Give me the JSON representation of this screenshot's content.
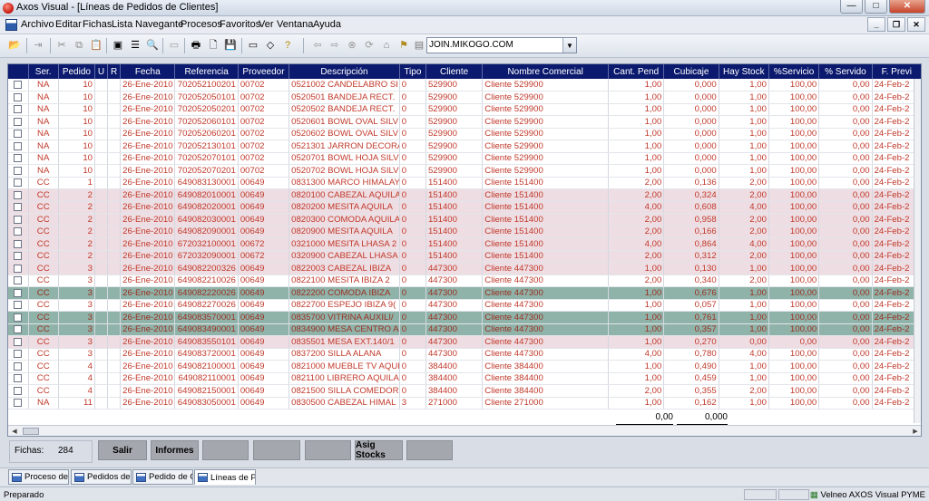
{
  "window": {
    "title": "Axos Visual - [Líneas de Pedidos de Clientes]"
  },
  "menu": [
    "Archivo",
    "Editar",
    "Fichas",
    "Lista",
    "Navegante",
    "Procesos",
    "Favoritos",
    "Ver",
    "Ventana",
    "Ayuda"
  ],
  "toolbar": {
    "combo_value": "JOIN.MIKOGO.COM"
  },
  "table": {
    "columns": [
      "",
      "Ser.",
      "Pedido",
      "U",
      "R",
      "Fecha",
      "Referencia",
      "Proveedor",
      "Descripción",
      "Tipo",
      "Cliente",
      "Nombre Comercial",
      "Cant. Pend",
      "Cubicaje",
      "Hay Stock",
      "%Servicio",
      "% Servido",
      "F. Previ"
    ],
    "rows": [
      {
        "ser": "NA",
        "pedido": "10",
        "fecha": "26-Ene-2010",
        "ref": "702052100201",
        "prov": "00702",
        "desc": "0521002 CANDELABRO SI",
        "tipo": "0",
        "cliente": "529900",
        "nombre": "Cliente 529900",
        "cant": "1,00",
        "cub": "0,000",
        "stock": "1,00",
        "serv": "100,00",
        "servido": "0,00",
        "fprev": "24-Feb-2",
        "style": "na"
      },
      {
        "ser": "NA",
        "pedido": "10",
        "fecha": "26-Ene-2010",
        "ref": "702052050101",
        "prov": "00702",
        "desc": "0520501 BANDEJA RECT.",
        "tipo": "0",
        "cliente": "529900",
        "nombre": "Cliente 529900",
        "cant": "1,00",
        "cub": "0,000",
        "stock": "1,00",
        "serv": "100,00",
        "servido": "0,00",
        "fprev": "24-Feb-2",
        "style": "na"
      },
      {
        "ser": "NA",
        "pedido": "10",
        "fecha": "26-Ene-2010",
        "ref": "702052050201",
        "prov": "00702",
        "desc": "0520502 BANDEJA RECT.",
        "tipo": "0",
        "cliente": "529900",
        "nombre": "Cliente 529900",
        "cant": "1,00",
        "cub": "0,000",
        "stock": "1,00",
        "serv": "100,00",
        "servido": "0,00",
        "fprev": "24-Feb-2",
        "style": "na"
      },
      {
        "ser": "NA",
        "pedido": "10",
        "fecha": "26-Ene-2010",
        "ref": "702052060101",
        "prov": "00702",
        "desc": "0520601 BOWL OVAL SILV",
        "tipo": "0",
        "cliente": "529900",
        "nombre": "Cliente 529900",
        "cant": "1,00",
        "cub": "0,000",
        "stock": "1,00",
        "serv": "100,00",
        "servido": "0,00",
        "fprev": "24-Feb-2",
        "style": "na"
      },
      {
        "ser": "NA",
        "pedido": "10",
        "fecha": "26-Ene-2010",
        "ref": "702052060201",
        "prov": "00702",
        "desc": "0520602 BOWL OVAL SILV",
        "tipo": "0",
        "cliente": "529900",
        "nombre": "Cliente 529900",
        "cant": "1,00",
        "cub": "0,000",
        "stock": "1,00",
        "serv": "100,00",
        "servido": "0,00",
        "fprev": "24-Feb-2",
        "style": "na"
      },
      {
        "ser": "NA",
        "pedido": "10",
        "fecha": "26-Ene-2010",
        "ref": "702052130101",
        "prov": "00702",
        "desc": "0521301 JARRON DECORA",
        "tipo": "0",
        "cliente": "529900",
        "nombre": "Cliente 529900",
        "cant": "1,00",
        "cub": "0,000",
        "stock": "1,00",
        "serv": "100,00",
        "servido": "0,00",
        "fprev": "24-Feb-2",
        "style": "na"
      },
      {
        "ser": "NA",
        "pedido": "10",
        "fecha": "26-Ene-2010",
        "ref": "702052070101",
        "prov": "00702",
        "desc": "0520701 BOWL HOJA SILV",
        "tipo": "0",
        "cliente": "529900",
        "nombre": "Cliente 529900",
        "cant": "1,00",
        "cub": "0,000",
        "stock": "1,00",
        "serv": "100,00",
        "servido": "0,00",
        "fprev": "24-Feb-2",
        "style": "na"
      },
      {
        "ser": "NA",
        "pedido": "10",
        "fecha": "26-Ene-2010",
        "ref": "702052070201",
        "prov": "00702",
        "desc": "0520702 BOWL HOJA SILV",
        "tipo": "0",
        "cliente": "529900",
        "nombre": "Cliente 529900",
        "cant": "1,00",
        "cub": "0,000",
        "stock": "1,00",
        "serv": "100,00",
        "servido": "0,00",
        "fprev": "24-Feb-2",
        "style": "na"
      },
      {
        "ser": "CC",
        "pedido": "1",
        "fecha": "26-Ene-2010",
        "ref": "649083130001",
        "prov": "00649",
        "desc": "0831300 MARCO HIMALAY",
        "tipo": "0",
        "cliente": "151400",
        "nombre": "Cliente 151400",
        "cant": "2,00",
        "cub": "0,136",
        "stock": "2,00",
        "serv": "100,00",
        "servido": "0,00",
        "fprev": "24-Feb-2",
        "style": "cc white"
      },
      {
        "ser": "CC",
        "pedido": "2",
        "fecha": "26-Ene-2010",
        "ref": "649082010001",
        "prov": "00649",
        "desc": "0820100 CABEZAL AQUILA",
        "tipo": "0",
        "cliente": "151400",
        "nombre": "Cliente 151400",
        "cant": "2,00",
        "cub": "0,324",
        "stock": "2,00",
        "serv": "100,00",
        "servido": "0,00",
        "fprev": "24-Feb-2",
        "style": "cc"
      },
      {
        "ser": "CC",
        "pedido": "2",
        "fecha": "26-Ene-2010",
        "ref": "649082020001",
        "prov": "00649",
        "desc": "0820200 MESITA AQUILA",
        "tipo": "0",
        "cliente": "151400",
        "nombre": "Cliente 151400",
        "cant": "4,00",
        "cub": "0,608",
        "stock": "4,00",
        "serv": "100,00",
        "servido": "0,00",
        "fprev": "24-Feb-2",
        "style": "cc"
      },
      {
        "ser": "CC",
        "pedido": "2",
        "fecha": "26-Ene-2010",
        "ref": "649082030001",
        "prov": "00649",
        "desc": "0820300 COMODA AQUILA",
        "tipo": "0",
        "cliente": "151400",
        "nombre": "Cliente 151400",
        "cant": "2,00",
        "cub": "0,958",
        "stock": "2,00",
        "serv": "100,00",
        "servido": "0,00",
        "fprev": "24-Feb-2",
        "style": "cc"
      },
      {
        "ser": "CC",
        "pedido": "2",
        "fecha": "26-Ene-2010",
        "ref": "649082090001",
        "prov": "00649",
        "desc": "0820900 MESITA AQUILA",
        "tipo": "0",
        "cliente": "151400",
        "nombre": "Cliente 151400",
        "cant": "2,00",
        "cub": "0,166",
        "stock": "2,00",
        "serv": "100,00",
        "servido": "0,00",
        "fprev": "24-Feb-2",
        "style": "cc"
      },
      {
        "ser": "CC",
        "pedido": "2",
        "fecha": "26-Ene-2010",
        "ref": "672032100001",
        "prov": "00672",
        "desc": "0321000 MESITA LHASA 2",
        "tipo": "0",
        "cliente": "151400",
        "nombre": "Cliente 151400",
        "cant": "4,00",
        "cub": "0,864",
        "stock": "4,00",
        "serv": "100,00",
        "servido": "0,00",
        "fprev": "24-Feb-2",
        "style": "cc"
      },
      {
        "ser": "CC",
        "pedido": "2",
        "fecha": "26-Ene-2010",
        "ref": "672032090001",
        "prov": "00672",
        "desc": "0320900 CABEZAL LHASA",
        "tipo": "0",
        "cliente": "151400",
        "nombre": "Cliente 151400",
        "cant": "2,00",
        "cub": "0,312",
        "stock": "2,00",
        "serv": "100,00",
        "servido": "0,00",
        "fprev": "24-Feb-2",
        "style": "cc"
      },
      {
        "ser": "CC",
        "pedido": "3",
        "fecha": "26-Ene-2010",
        "ref": "649082200326",
        "prov": "00649",
        "desc": "0822003 CABEZAL IBIZA",
        "tipo": "0",
        "cliente": "447300",
        "nombre": "Cliente 447300",
        "cant": "1,00",
        "cub": "0,130",
        "stock": "1,00",
        "serv": "100,00",
        "servido": "0,00",
        "fprev": "24-Feb-2",
        "style": "cc"
      },
      {
        "ser": "CC",
        "pedido": "3",
        "fecha": "26-Ene-2010",
        "ref": "649082210026",
        "prov": "00649",
        "desc": "0822100 MESITA IBIZA 2",
        "tipo": "0",
        "cliente": "447300",
        "nombre": "Cliente 447300",
        "cant": "2,00",
        "cub": "0,340",
        "stock": "2,00",
        "serv": "100,00",
        "servido": "0,00",
        "fprev": "24-Feb-2",
        "style": "cc white"
      },
      {
        "ser": "CC",
        "pedido": "3",
        "fecha": "26-Ene-2010",
        "ref": "649082220026",
        "prov": "00649",
        "desc": "0822200 COMODA IBIZA",
        "tipo": "0",
        "cliente": "447300",
        "nombre": "Cliente 447300",
        "cant": "1,00",
        "cub": "0,676",
        "stock": "1,00",
        "serv": "100,00",
        "servido": "0,00",
        "fprev": "24-Feb-2",
        "style": "sel"
      },
      {
        "ser": "CC",
        "pedido": "3",
        "fecha": "26-Ene-2010",
        "ref": "649082270026",
        "prov": "00649",
        "desc": "0822700 ESPEJO IBIZA 9(",
        "tipo": "0",
        "cliente": "447300",
        "nombre": "Cliente 447300",
        "cant": "1,00",
        "cub": "0,057",
        "stock": "1,00",
        "serv": "100,00",
        "servido": "0,00",
        "fprev": "24-Feb-2",
        "style": "cc white"
      },
      {
        "ser": "CC",
        "pedido": "3",
        "fecha": "26-Ene-2010",
        "ref": "649083570001",
        "prov": "00649",
        "desc": "0835700 VITRINA AUXILI/",
        "tipo": "0",
        "cliente": "447300",
        "nombre": "Cliente 447300",
        "cant": "1,00",
        "cub": "0,761",
        "stock": "1,00",
        "serv": "100,00",
        "servido": "0,00",
        "fprev": "24-Feb-2",
        "style": "sel"
      },
      {
        "ser": "CC",
        "pedido": "3",
        "fecha": "26-Ene-2010",
        "ref": "649083490001",
        "prov": "00649",
        "desc": "0834900 MESA CENTRO A",
        "tipo": "0",
        "cliente": "447300",
        "nombre": "Cliente 447300",
        "cant": "1,00",
        "cub": "0,357",
        "stock": "1,00",
        "serv": "100,00",
        "servido": "0,00",
        "fprev": "24-Feb-2",
        "style": "sel"
      },
      {
        "ser": "CC",
        "pedido": "3",
        "fecha": "26-Ene-2010",
        "ref": "649083550101",
        "prov": "00649",
        "desc": "0835501 MESA EXT.140/1",
        "tipo": "0",
        "cliente": "447300",
        "nombre": "Cliente 447300",
        "cant": "1,00",
        "cub": "0,270",
        "stock": "0,00",
        "serv": "0,00",
        "servido": "0,00",
        "fprev": "24-Feb-2",
        "style": "cc"
      },
      {
        "ser": "CC",
        "pedido": "3",
        "fecha": "26-Ene-2010",
        "ref": "649083720001",
        "prov": "00649",
        "desc": "0837200 SILLA ALANA",
        "tipo": "0",
        "cliente": "447300",
        "nombre": "Cliente 447300",
        "cant": "4,00",
        "cub": "0,780",
        "stock": "4,00",
        "serv": "100,00",
        "servido": "0,00",
        "fprev": "24-Feb-2",
        "style": "cc white"
      },
      {
        "ser": "CC",
        "pedido": "4",
        "fecha": "26-Ene-2010",
        "ref": "649082100001",
        "prov": "00649",
        "desc": "0821000 MUEBLE TV AQUI",
        "tipo": "0",
        "cliente": "384400",
        "nombre": "Cliente 384400",
        "cant": "1,00",
        "cub": "0,490",
        "stock": "1,00",
        "serv": "100,00",
        "servido": "0,00",
        "fprev": "24-Feb-2",
        "style": "cc white"
      },
      {
        "ser": "CC",
        "pedido": "4",
        "fecha": "26-Ene-2010",
        "ref": "649082110001",
        "prov": "00649",
        "desc": "0821100 LIBRERO AQUILA",
        "tipo": "0",
        "cliente": "384400",
        "nombre": "Cliente 384400",
        "cant": "1,00",
        "cub": "0,459",
        "stock": "1,00",
        "serv": "100,00",
        "servido": "0,00",
        "fprev": "24-Feb-2",
        "style": "cc white"
      },
      {
        "ser": "CC",
        "pedido": "4",
        "fecha": "26-Ene-2010",
        "ref": "649082150001",
        "prov": "00649",
        "desc": "0821500 SILLA COMEDOR",
        "tipo": "0",
        "cliente": "384400",
        "nombre": "Cliente 384400",
        "cant": "2,00",
        "cub": "0,355",
        "stock": "2,00",
        "serv": "100,00",
        "servido": "0,00",
        "fprev": "24-Feb-2",
        "style": "cc white"
      },
      {
        "ser": "NA",
        "pedido": "11",
        "fecha": "26-Ene-2010",
        "ref": "649083050001",
        "prov": "00649",
        "desc": "0830500 CABEZAL HIMAL",
        "tipo": "3",
        "cliente": "271000",
        "nombre": "Cliente 271000",
        "cant": "1,00",
        "cub": "0,162",
        "stock": "1,00",
        "serv": "100,00",
        "servido": "0,00",
        "fprev": "24-Feb-2",
        "style": "na"
      }
    ],
    "totals": {
      "cant": "0,00",
      "cub": "0,000"
    }
  },
  "footer": {
    "fichas_label": "Fichas:",
    "fichas_value": "284",
    "buttons": [
      "Salir",
      "Informes",
      "",
      "",
      "",
      "Asig Stocks",
      ""
    ]
  },
  "tabs": [
    "Proceso de ...",
    "Pedidos de ...",
    "Pedido de C...",
    "Líneas de P..."
  ],
  "status": {
    "text": "Preparado",
    "app": "Velneo AXOS Visual PYME"
  },
  "colors": {
    "header_bg": "#0b1a6e",
    "row_pink": "#eedde2",
    "row_selected": "#8fb3a8",
    "text_red": "#c0392b"
  }
}
